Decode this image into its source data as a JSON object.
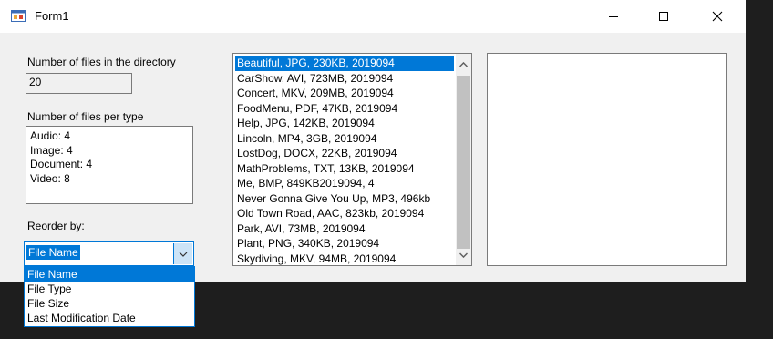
{
  "window": {
    "title": "Form1",
    "controls": {
      "minimize": "minimize",
      "maximize": "maximize",
      "close": "close"
    }
  },
  "files_count": {
    "label": "Number of files in the directory",
    "value": "20"
  },
  "files_per_type": {
    "label": "Number of files per type",
    "lines": [
      "Audio: 4",
      "Image: 4",
      "Document: 4",
      "Video: 8"
    ]
  },
  "reorder": {
    "label": "Reorder by:",
    "selected": "File Name",
    "options": [
      "File Name",
      "File Type",
      "File Size",
      "Last Modification Date"
    ]
  },
  "file_list": {
    "items": [
      "Beautiful, JPG, 230KB, 2019094",
      "CarShow, AVI, 723MB, 2019094",
      "Concert, MKV, 209MB, 2019094",
      "FoodMenu, PDF, 47KB, 2019094",
      "Help, JPG, 142KB, 2019094",
      "Lincoln, MP4, 3GB, 2019094",
      "LostDog, DOCX, 22KB, 2019094",
      "MathProblems, TXT, 13KB, 2019094",
      "Me, BMP, 849KB2019094, 4",
      "Never Gonna Give You Up, MP3, 496kb",
      "Old Town Road, AAC, 823kb, 2019094",
      "Park, AVI, 73MB, 2019094",
      "Plant, PNG, 340KB, 2019094",
      "Skydiving, MKV, 94MB, 2019094"
    ],
    "selected_index": 0
  },
  "icons": {
    "app": "form-app-icon",
    "scroll_up": "chevron-up-icon",
    "scroll_down": "chevron-down-icon",
    "combo": "chevron-down-icon"
  },
  "colors": {
    "selection": "#0078d7",
    "window_bg": "#f0f0f0",
    "backdrop": "#1e1e1e"
  }
}
